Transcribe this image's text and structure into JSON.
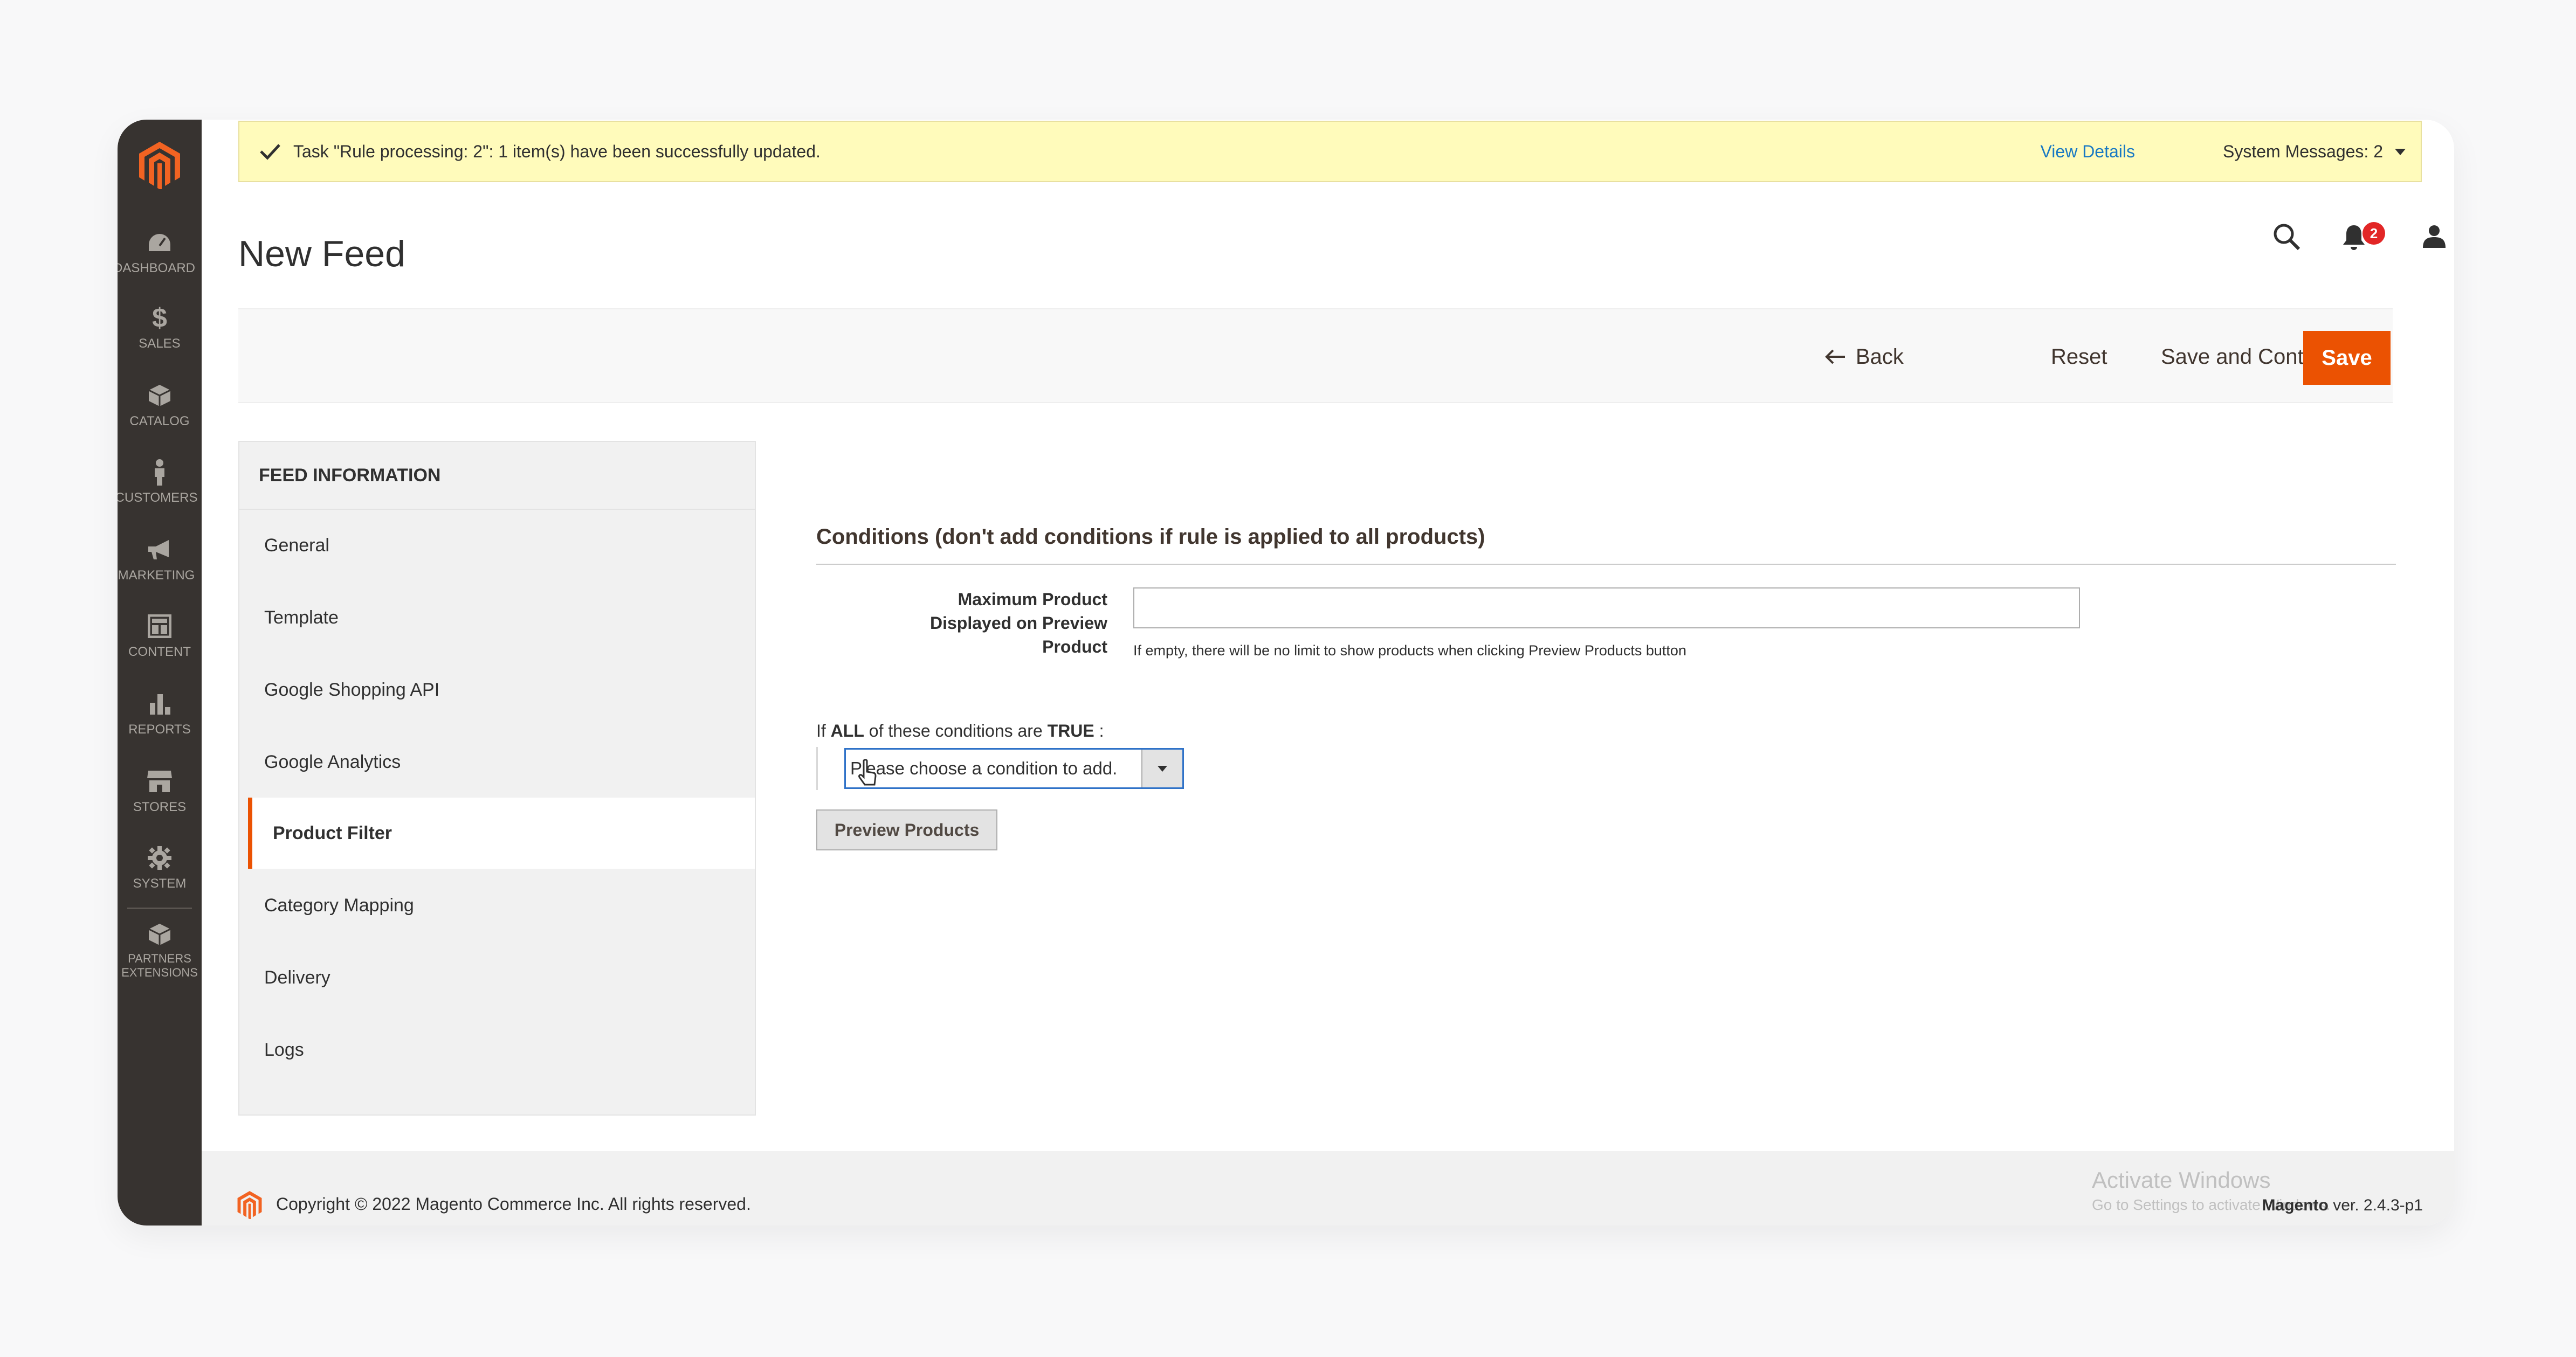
{
  "sidebar": {
    "items": [
      {
        "label": "DASHBOARD",
        "icon": "dashboard-icon"
      },
      {
        "label": "SALES",
        "icon": "dollar-icon"
      },
      {
        "label": "CATALOG",
        "icon": "box-icon"
      },
      {
        "label": "CUSTOMERS",
        "icon": "person-icon"
      },
      {
        "label": "MARKETING",
        "icon": "megaphone-icon"
      },
      {
        "label": "CONTENT",
        "icon": "layout-icon"
      },
      {
        "label": "REPORTS",
        "icon": "bar-chart-icon"
      },
      {
        "label": "STORES",
        "icon": "store-icon"
      },
      {
        "label": "SYSTEM",
        "icon": "gear-icon"
      },
      {
        "label": "PARTNERS EXTENSIONS",
        "icon": "extension-box-icon"
      }
    ]
  },
  "notice": {
    "message": "Task \"Rule processing: 2\": 1 item(s) have been successfully updated.",
    "view_details": "View Details",
    "system_messages": "System Messages: 2"
  },
  "header": {
    "title": "New Feed",
    "notifications_count": "2",
    "user": "admin"
  },
  "actions": {
    "back": "Back",
    "reset": "Reset",
    "save_continue": "Save and Continue Edit",
    "save": "Save"
  },
  "tabs": {
    "heading": "FEED INFORMATION",
    "items": [
      "General",
      "Template",
      "Google Shopping API",
      "Google Analytics",
      "Product Filter",
      "Category Mapping",
      "Delivery",
      "Logs"
    ],
    "active": "Product Filter"
  },
  "form": {
    "section_title": "Conditions (don't add conditions if rule is applied to all products)",
    "max_label": "Maximum Product Displayed on Preview Product",
    "max_value": "",
    "max_note": "If empty, there will be no limit to show products when clicking Preview Products button",
    "cond_if": "If",
    "cond_all": "ALL",
    "cond_mid": "of these conditions are",
    "cond_true": "TRUE",
    "cond_end": ":",
    "condition_select": "Please choose a condition to add.",
    "preview_button": "Preview Products"
  },
  "footer": {
    "copyright": "Copyright © 2022 Magento Commerce Inc. All rights reserved.",
    "activate_title": "Activate Windows",
    "activate_sub": "Go to Settings to activate Windows.",
    "brand": "Magento",
    "version": "ver. 2.4.3-p1"
  },
  "colors": {
    "accent": "#eb5202",
    "sidebar": "#373330",
    "notice_bg": "#fffbbb",
    "link": "#1979c3"
  }
}
